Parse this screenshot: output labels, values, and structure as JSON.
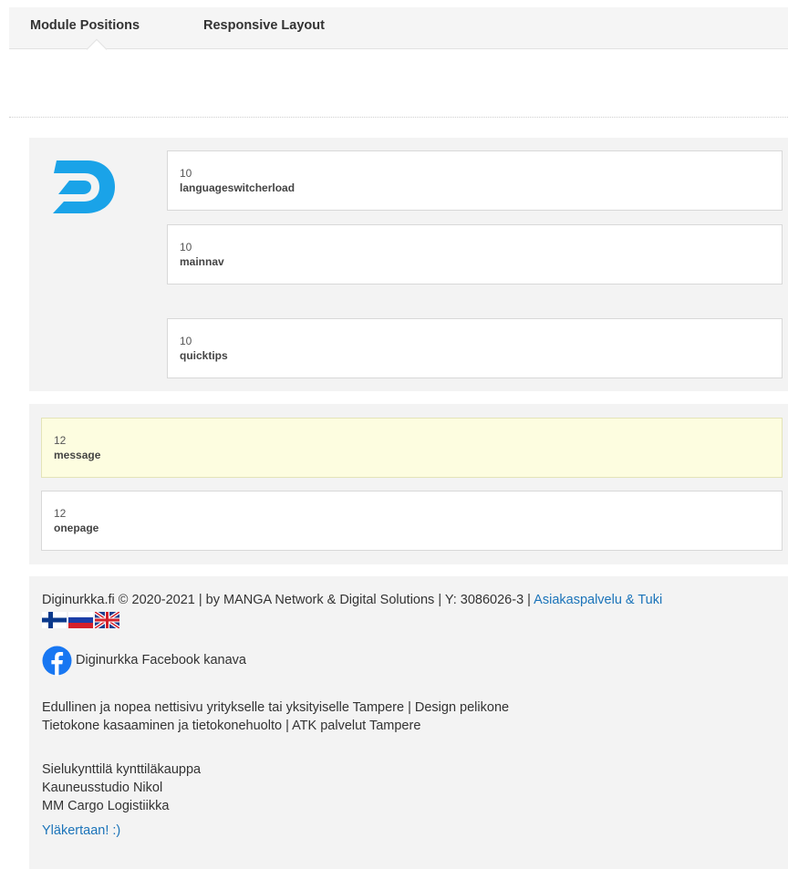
{
  "tabs": [
    {
      "label": "Module Positions",
      "active": true
    },
    {
      "label": "Responsive Layout",
      "active": false
    }
  ],
  "header_row": {
    "logo": {
      "icon": "diginurkka-d-logo-icon",
      "color": "#1aa3e8"
    },
    "positions": [
      {
        "span": "10",
        "name": "languageswitcherload"
      },
      {
        "span": "10",
        "name": "mainnav"
      },
      {
        "span": "10",
        "name": "quicktips"
      }
    ]
  },
  "main_row": {
    "positions": [
      {
        "span": "12",
        "name": "message",
        "highlight": true
      },
      {
        "span": "12",
        "name": "onepage",
        "highlight": false
      }
    ]
  },
  "footer": {
    "copyright": "Diginurkka.fi © 2020-2021 | by MANGA Network & Digital Solutions | Y: 3086026-3 | ",
    "support_link": "Asiakaspalvelu & Tuki",
    "flags": [
      "finland-flag-icon",
      "russia-flag-icon",
      "uk-flag-icon"
    ],
    "facebook_label": "Diginurkka Facebook kanava",
    "links": [
      "Edullinen ja nopea nettisivu yritykselle tai yksityiselle Tampere | Design pelikone",
      "Tietokone kasaaminen ja tietokonehuolto | ATK palvelut Tampere"
    ],
    "shops": [
      "Sielukynttilä kynttiläkauppa",
      "Kauneusstudio Nikol",
      "MM Cargo Logistiikka"
    ],
    "back_to_top": "Yläkertaan! :)"
  },
  "colors": {
    "link": "#1a73b9",
    "highlight_bg": "#fdfde0",
    "section_bg": "#f3f3f3",
    "facebook": "#1877f2"
  }
}
